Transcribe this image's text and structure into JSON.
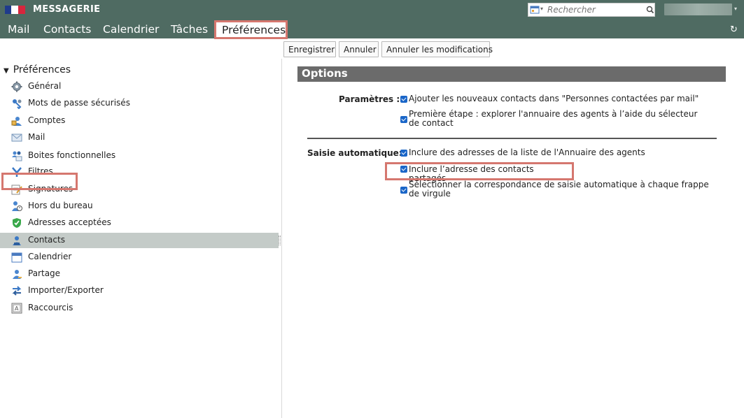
{
  "app": {
    "title": "MESSAGERIE"
  },
  "search": {
    "placeholder": "Rechercher"
  },
  "nav": {
    "items": [
      "Mail",
      "Contacts",
      "Calendrier",
      "Tâches",
      "Préférences"
    ],
    "active": "Préférences"
  },
  "toolbar": {
    "save": "Enregistrer",
    "cancel": "Annuler",
    "revert": "Annuler les modifications"
  },
  "sidebar": {
    "title": "Préférences",
    "items": [
      {
        "label": "Général",
        "icon": "gear-icon"
      },
      {
        "label": "Mots de passe sécurisés",
        "icon": "key-icon"
      },
      {
        "label": "Comptes",
        "icon": "accounts-icon"
      },
      {
        "label": "Mail",
        "icon": "envelope-icon"
      },
      {
        "label": "Boites fonctionnelles",
        "icon": "shared-mailbox-icon"
      },
      {
        "label": "Filtres",
        "icon": "filter-icon"
      },
      {
        "label": "Signatures",
        "icon": "signature-icon"
      },
      {
        "label": "Hors du bureau",
        "icon": "out-of-office-icon"
      },
      {
        "label": "Adresses acceptées",
        "icon": "shield-check-icon"
      },
      {
        "label": "Contacts",
        "icon": "contacts-icon"
      },
      {
        "label": "Calendrier",
        "icon": "calendar-icon"
      },
      {
        "label": "Partage",
        "icon": "share-icon"
      },
      {
        "label": "Importer/Exporter",
        "icon": "import-export-icon"
      },
      {
        "label": "Raccourcis",
        "icon": "shortcut-icon"
      }
    ],
    "selected": "Contacts"
  },
  "main": {
    "section_title": "Options",
    "groups": [
      {
        "label": "Paramètres :",
        "options": [
          {
            "text": "Ajouter les nouveaux contacts dans \"Personnes contactées par mail\"",
            "checked": true
          },
          {
            "text": "Première étape : explorer l'annuaire des agents à l’aide du sélecteur de contact",
            "checked": true
          }
        ]
      },
      {
        "label": "Saisie automatique:",
        "options": [
          {
            "text": "Inclure des adresses de la liste de l'Annuaire des agents",
            "checked": true
          },
          {
            "text": "Inclure l’adresse des contacts partagés",
            "checked": true
          },
          {
            "text": "Sélectionner la correspondance de saisie automatique à chaque frappe de virgule",
            "checked": true
          }
        ]
      }
    ]
  },
  "colors": {
    "header_bg": "#4f6b62",
    "highlight_border": "#d5776f",
    "selected_row_bg": "#c4cbc8",
    "options_bar_bg": "#6b6b6b",
    "checkbox_blue": "#1a66c8"
  }
}
